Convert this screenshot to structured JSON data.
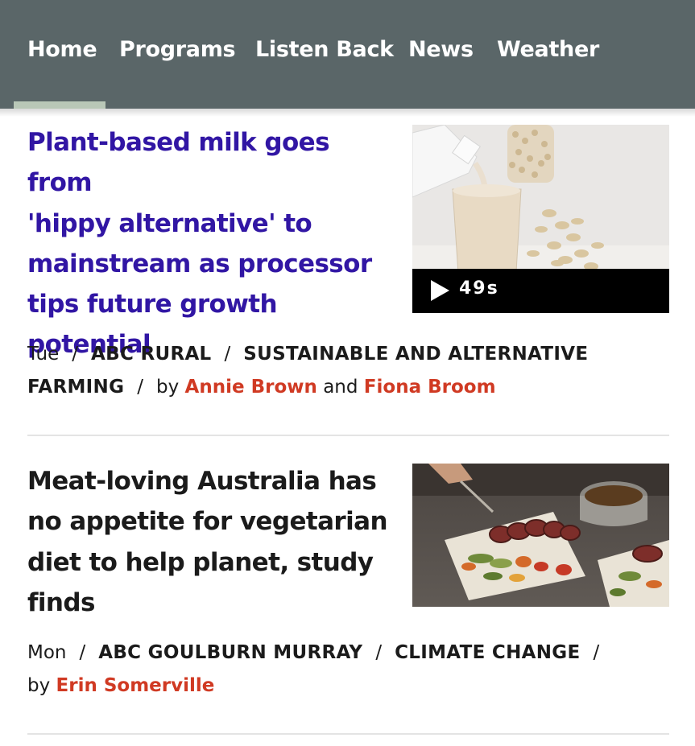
{
  "nav": {
    "tabs": [
      {
        "label": "Home",
        "active": true
      },
      {
        "label": "Programs",
        "active": false
      },
      {
        "label": "Listen Back",
        "active": false
      },
      {
        "label": "News",
        "active": false
      },
      {
        "label": "Weather",
        "active": false
      }
    ],
    "background_color": "#5a6668",
    "active_indicator_color": "#b9c7b7"
  },
  "articles": [
    {
      "headline": "Plant-based milk goes from 'hippy alternative' to mainstream as processor tips future growth potential",
      "headline_lines": [
        "Plant-based milk goes from",
        "'hippy alternative' to",
        "mainstream as processor",
        "tips future growth",
        "potential"
      ],
      "visited": true,
      "image_description_icon": "oat-milk-photo",
      "video_duration": "49s",
      "day": "Tue",
      "categories": [
        "ABC RURAL",
        "SUSTAINABLE AND ALTERNATIVE FARMING"
      ],
      "by_label": "by",
      "and_label": "and",
      "authors": [
        "Annie Brown",
        "Fiona Broom"
      ]
    },
    {
      "headline": "Meat-loving Australia has no appetite for vegetarian diet to help planet, study finds",
      "headline_lines": [
        "Meat-loving Australia has",
        "no appetite for vegetarian",
        "diet to help planet, study",
        "finds"
      ],
      "visited": false,
      "image_description_icon": "plated-meat-photo",
      "day": "Mon",
      "categories": [
        "ABC GOULBURN MURRAY",
        "CLIMATE CHANGE"
      ],
      "by_label": "by",
      "authors": [
        "Erin Somerville"
      ]
    }
  ],
  "colors": {
    "visited_headline": "#3116a4",
    "headline": "#1b1b1b",
    "author_link": "#d03a23"
  }
}
